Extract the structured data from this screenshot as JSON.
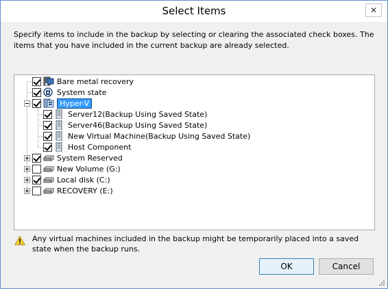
{
  "window": {
    "title": "Select Items",
    "close_glyph": "✕"
  },
  "instructions": "Specify items to include in the backup by selecting or clearing the associated check boxes. The items that you have included in the current backup are already selected.",
  "tree": {
    "bare_metal": "Bare metal recovery",
    "system_state": "System state",
    "hyperv": "Hyper-V",
    "server12": "Server12(Backup Using Saved State)",
    "server46": "Server46(Backup Using Saved State)",
    "new_vm": "New Virtual Machine(Backup Using Saved State)",
    "host_component": "Host Component",
    "system_reserved": "System Reserved",
    "new_volume": "New Volume (G:)",
    "local_disk": "Local disk (C:)",
    "recovery": "RECOVERY (E:)"
  },
  "warning": "Any virtual machines included in the backup might be temporarily placed into a saved state when the backup runs.",
  "buttons": {
    "ok": "OK",
    "cancel": "Cancel"
  }
}
